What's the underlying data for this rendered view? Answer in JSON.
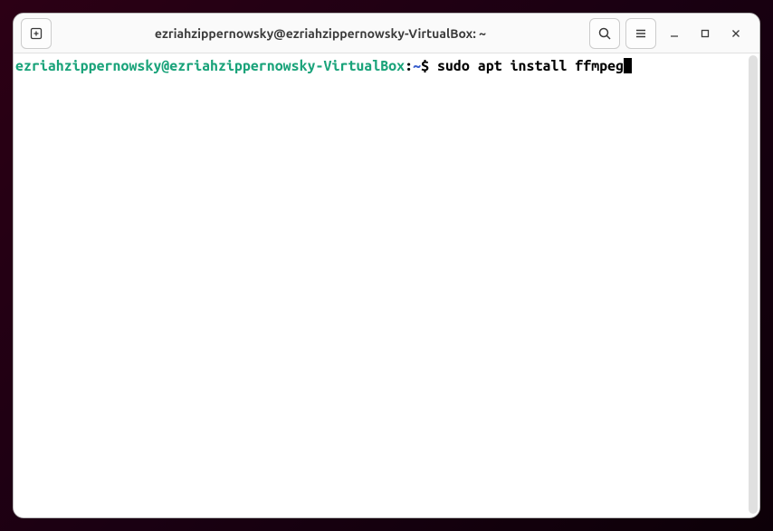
{
  "window": {
    "title": "ezriahzippernowsky@ezriahzippernowsky-VirtualBox: ~"
  },
  "terminal": {
    "prompt": {
      "user_host": "ezriahzippernowsky@ezriahzippernowsky-VirtualBox",
      "separator": ":",
      "path": "~",
      "symbol": "$"
    },
    "command": " sudo apt install ffmpeg"
  }
}
